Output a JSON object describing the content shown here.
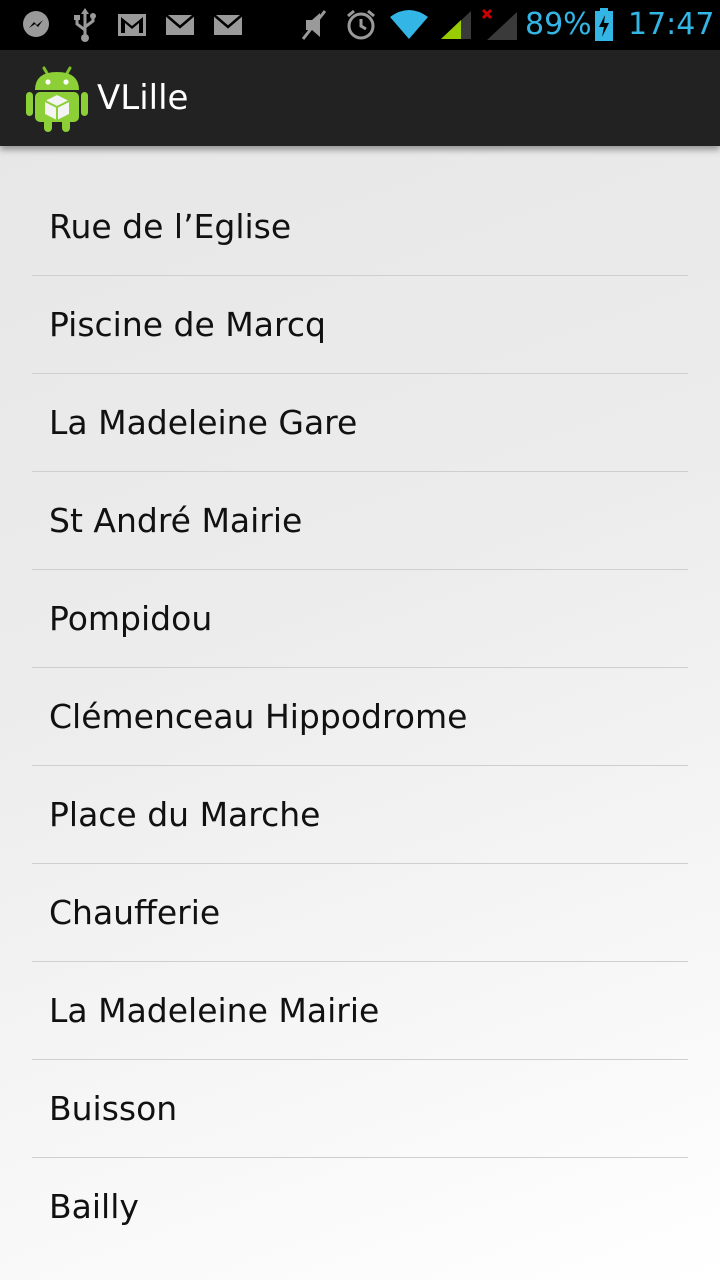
{
  "status_bar": {
    "battery_percent": "89%",
    "time": "17:47",
    "icons": [
      "messenger-icon",
      "usb-icon",
      "gmail-icon",
      "email-icon",
      "email-icon",
      "mute-icon",
      "alarm-icon",
      "wifi-icon",
      "signal-icon",
      "no-signal-icon",
      "battery-charging-icon"
    ]
  },
  "action_bar": {
    "title": "VLille",
    "icon": "android-app-icon"
  },
  "stations": [
    {
      "name": "Rue de l’Eglise"
    },
    {
      "name": "Piscine de Marcq"
    },
    {
      "name": "La Madeleine Gare"
    },
    {
      "name": "St André Mairie"
    },
    {
      "name": "Pompidou"
    },
    {
      "name": "Clémenceau Hippodrome"
    },
    {
      "name": "Place du Marche"
    },
    {
      "name": "Chaufferie"
    },
    {
      "name": "La Madeleine Mairie"
    },
    {
      "name": "Buisson"
    },
    {
      "name": "Bailly"
    }
  ],
  "colors": {
    "status_accent": "#33b5e5",
    "action_bar_bg": "#222222",
    "list_text": "#111111",
    "divider": "#cfcfcf"
  }
}
